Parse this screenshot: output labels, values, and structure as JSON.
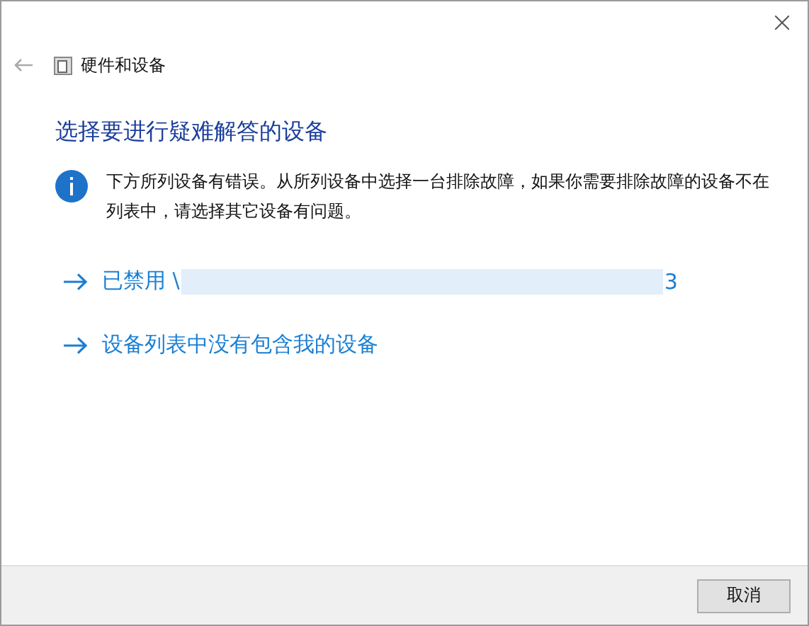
{
  "window": {
    "title": "硬件和设备"
  },
  "heading": "选择要进行疑难解答的设备",
  "info": "下方所列设备有错误。从所列设备中选择一台排除故障，如果你需要排除故障的设备不在列表中，请选择其它设备有问题。",
  "links": [
    {
      "label": "已禁用 \\",
      "redacted": true,
      "tail": "3"
    },
    {
      "label": "设备列表中没有包含我的设备",
      "redacted": false
    }
  ],
  "buttons": [
    "取消"
  ]
}
